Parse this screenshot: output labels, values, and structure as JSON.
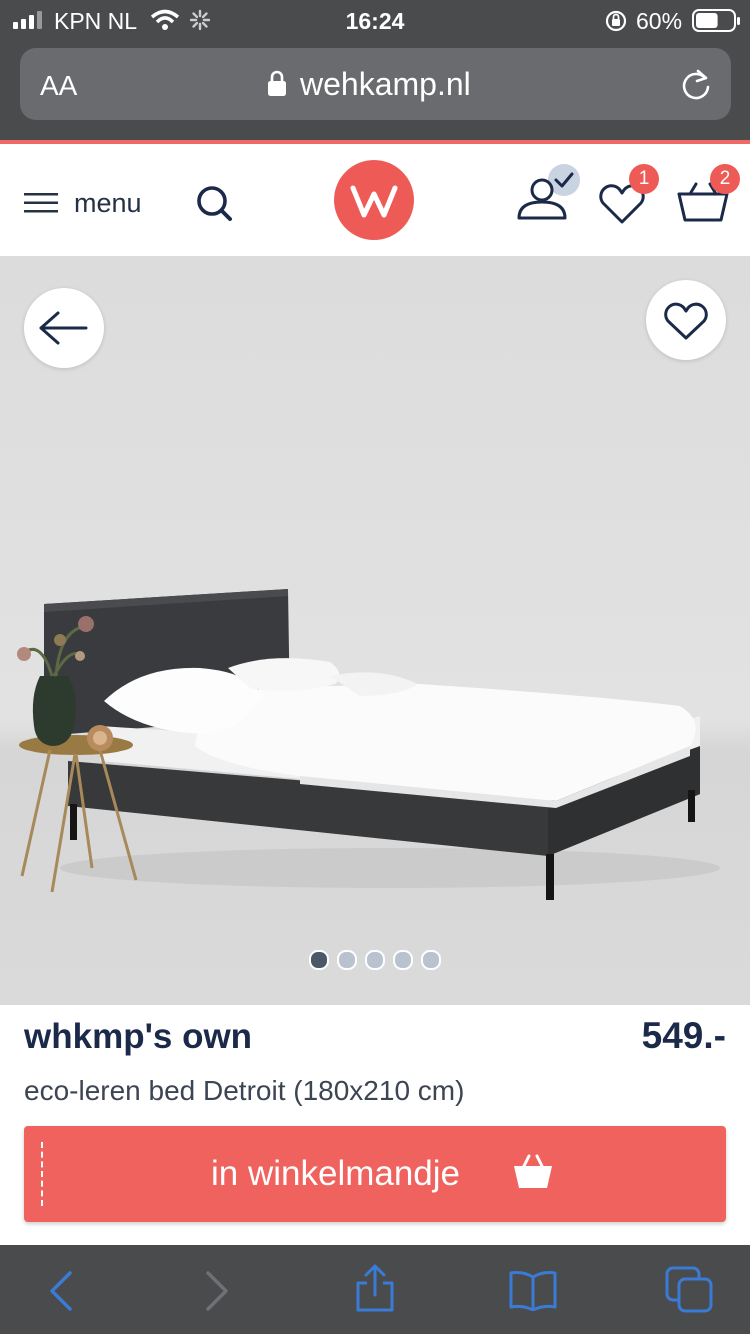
{
  "status_bar": {
    "carrier": "KPN NL",
    "time": "16:24",
    "battery_percent": "60%",
    "battery_level": 0.6
  },
  "url_bar": {
    "text_size_label": "AA",
    "domain": "wehkamp.nl"
  },
  "header": {
    "menu_label": "menu",
    "logo_letter": "w",
    "favorites_count": "1",
    "cart_count": "2"
  },
  "gallery": {
    "image_count": 5,
    "active_index": 0
  },
  "product": {
    "brand": "whkmp's own",
    "price": "549.-",
    "name": "eco-leren bed Detroit (180x210 cm)",
    "add_to_cart_label": "in winkelmandje"
  },
  "colors": {
    "accent": "#ee5b56",
    "text_dark": "#1c2a4a",
    "link_blue": "#3a7bd5"
  }
}
